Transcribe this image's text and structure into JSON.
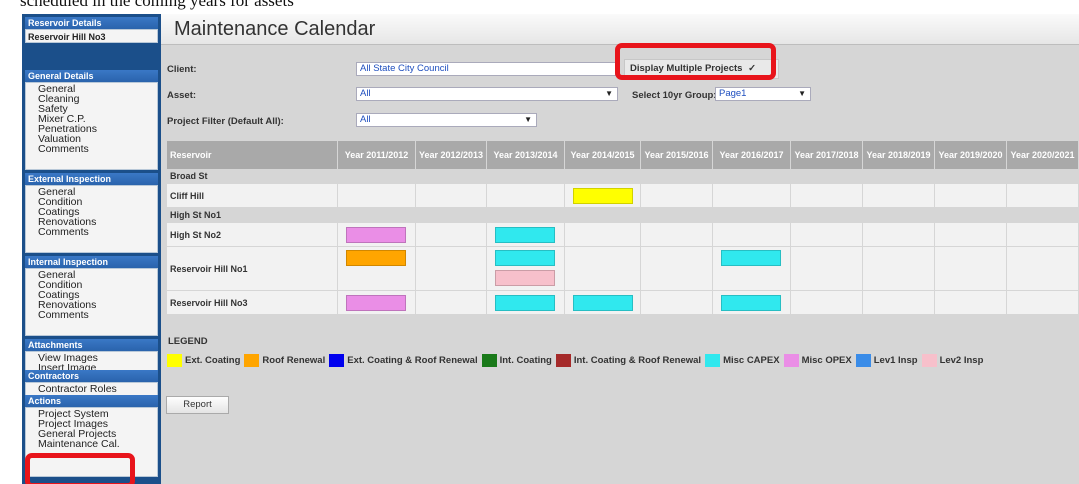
{
  "caption": "scheduled in the coming years for assets",
  "sidebar": {
    "sections": [
      {
        "header": "Reservoir Details",
        "items": [
          "Reservoir Hill No3"
        ],
        "bold": true
      },
      {
        "header": "General Details",
        "items": [
          "General",
          "Cleaning",
          "Safety",
          "Mixer C.P.",
          "Penetrations",
          "Valuation",
          "Comments"
        ]
      },
      {
        "header": "External Inspection",
        "items": [
          "General",
          "Condition",
          "Coatings",
          "Renovations",
          "Comments"
        ]
      },
      {
        "header": "Internal Inspection",
        "items": [
          "General",
          "Condition",
          "Coatings",
          "Renovations",
          "Comments"
        ]
      },
      {
        "header": "Attachments",
        "items": [
          "View Images",
          "Insert Image"
        ]
      },
      {
        "header": "Contractors",
        "items": [
          "Contractor Roles"
        ]
      },
      {
        "header": "Actions",
        "items": [
          "Project System",
          "Project Images",
          "General Projects",
          "Maintenance Cal."
        ]
      }
    ]
  },
  "main": {
    "title": "Maintenance Calendar",
    "client_label": "Client:",
    "client_value": "All State City Council",
    "asset_label": "Asset:",
    "asset_value": "All",
    "project_filter_label": "Project Filter (Default All):",
    "project_filter_value": "All",
    "display_multiple_label": "Display Multiple Projects",
    "display_multiple_checked": "✓",
    "group_label": "Select 10yr Group:",
    "group_value": "Page1",
    "dropdown_arrow": "▼"
  },
  "calendar": {
    "columns": [
      "Reservoir",
      "Year 2011/2012",
      "Year 2012/2013",
      "Year 2013/2014",
      "Year 2014/2015",
      "Year 2015/2016",
      "Year 2016/2017",
      "Year 2017/2018",
      "Year 2018/2019",
      "Year 2019/2020",
      "Year 2020/2021"
    ],
    "groups": [
      {
        "name": "Broad St",
        "rows": [
          {
            "name": "Cliff Hill",
            "bars": [
              {
                "col": 4,
                "color": "#ffff00"
              }
            ]
          }
        ]
      },
      {
        "name": "High St No1",
        "rows": [
          {
            "name": "High St No2",
            "bars": [
              {
                "col": 1,
                "color": "#ea8ee6"
              },
              {
                "col": 3,
                "color": "#30e8ee"
              }
            ]
          },
          {
            "name": "Reservoir Hill No1",
            "tall": true,
            "bars": [
              {
                "col": 1,
                "color": "#ffa500"
              },
              {
                "col": 3,
                "color": "#30e8ee"
              },
              {
                "col": 3,
                "color": "#f7c0cb",
                "stack": 2
              },
              {
                "col": 6,
                "color": "#30e8ee"
              }
            ]
          },
          {
            "name": "Reservoir Hill No3",
            "bars": [
              {
                "col": 1,
                "color": "#ea8ee6"
              },
              {
                "col": 3,
                "color": "#30e8ee"
              },
              {
                "col": 4,
                "color": "#30e8ee"
              },
              {
                "col": 6,
                "color": "#30e8ee"
              }
            ]
          }
        ]
      }
    ]
  },
  "legend": {
    "title": "LEGEND",
    "items": [
      {
        "label": "Ext. Coating",
        "color": "#ffff00"
      },
      {
        "label": "Roof Renewal",
        "color": "#ffa500"
      },
      {
        "label": "Ext. Coating & Roof Renewal",
        "color": "#0000ee"
      },
      {
        "label": "Int. Coating",
        "color": "#1a7a1a"
      },
      {
        "label": "Int. Coating & Roof Renewal",
        "color": "#a52a2a"
      },
      {
        "label": "Misc CAPEX",
        "color": "#30e8ee"
      },
      {
        "label": "Misc OPEX",
        "color": "#ea8ee6"
      },
      {
        "label": "Lev1 Insp",
        "color": "#3a8ce8"
      },
      {
        "label": "Lev2 Insp",
        "color": "#f7c0cb"
      }
    ]
  },
  "report_label": "Report",
  "highlight_color": "#e8141b"
}
